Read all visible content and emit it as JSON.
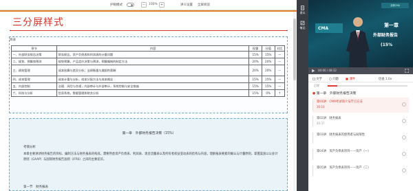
{
  "toolbar": {
    "mode_label": "护眼模式",
    "zoom_out": "−",
    "zoom_pct": "100%",
    "zoom_in": "+",
    "font_label": "讲义设置",
    "expand_label": "全屏阅读"
  },
  "doc": {
    "title": "三分屏样式",
    "outline_title": "目录",
    "table": {
      "headers": [
        "章节",
        "内容",
        "权重",
        "分值",
        "对比"
      ],
      "rows": [
        {
          "c": "一、外部财务报告决策",
          "k": "财务报告，资产负债表和利润表的计量问题",
          "w": "15%",
          "s": "15%",
          "d": "—"
        },
        {
          "c": "二、规划、预算和预测",
          "k": "规划预算，产品定价决策与预测，预算编制的制定方法",
          "w": "20%",
          "s": "20%",
          "d": "—"
        },
        {
          "c": "三、绩效管理",
          "k": "成本核算与差异分析；业绩衡量与激励性薪酬",
          "w": "20%",
          "s": "20%",
          "d": "—"
        },
        {
          "c": "四、成本管理",
          "k": "成本计量与分析，成本分配方法与成本概念",
          "w": "15%",
          "s": "15%",
          "d": "—"
        },
        {
          "c": "五、内部控制",
          "k": "治理、风险与合规，内部审计与外部审计，系统控制与安全措施",
          "w": "15%",
          "s": "15%",
          "d": "—"
        },
        {
          "c": "六、科技与分析",
          "k": "信息系统，数据管理和财务分析",
          "w": "15%",
          "s": "0%",
          "d": "↑"
        }
      ]
    },
    "chapter": {
      "title": "第一章　外部财务报告决策（15%）",
      "sub": "考情分析",
      "text": "本章主要讲述财务报告的目标、编制方法与财务报表的构成，需要熟悉资产负债表、利润表、现金流量表以及所有者权益变动表的结构与内容，理解报表要素的确认与计量原则，掌握美国公认会计原则（GAAP）与国际财务报告准则（IFRS）之间的主要差异。",
      "section": "第一节　财务报表"
    }
  },
  "sidebar": {
    "btn1": "讲义",
    "btn2": "笔记"
  },
  "player": {
    "logo": "高顿CMA",
    "cma": "CMA",
    "chapter_no": "第一章",
    "chapter_name": "外部财务报告",
    "chapter_pct": "(15%",
    "time": "00:00 / 48:32"
  },
  "tabs": {
    "t1": "文字",
    "t2": "问题",
    "t3": "课件",
    "speed": "倍速 1.0x"
  },
  "progress": {
    "label": "已学",
    "fraction": 0.12
  },
  "catalog": {
    "chapter": "第一章　外部财务报告决策",
    "items": [
      {
        "no": "第01讲　CMA考试简介与学习方法",
        "time": "30:10",
        "active": true
      },
      {
        "no": "第02讲　财务报表",
        "time": "40:37",
        "active": false
      },
      {
        "no": "第03讲　财务报表的使用者与局限性",
        "time": "",
        "active": false
      },
      {
        "no": "第04讲　资产负债表项目——资产（一）",
        "time": "",
        "active": false
      },
      {
        "no": "第05讲　资产负债表项目——资产（二）",
        "time": "",
        "active": false
      }
    ]
  }
}
